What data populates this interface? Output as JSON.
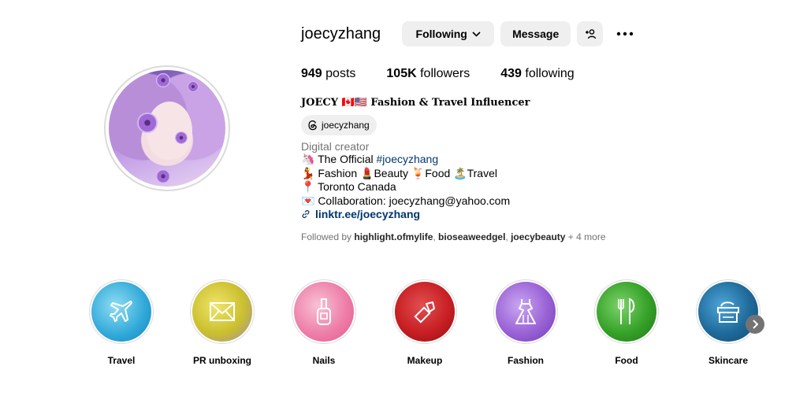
{
  "profile": {
    "username": "joecyzhang",
    "following_label": "Following",
    "message_label": "Message",
    "posts_count": "949",
    "posts_label": "posts",
    "followers_count": "105K",
    "followers_label": "followers",
    "following_count": "439",
    "following_count_label": "following",
    "full_name": "JOECY 🇨🇦🇺🇸 Fashion & Travel Influencer",
    "threads_handle": "joecyzhang",
    "category": "Digital creator",
    "bio": {
      "line1_prefix": "🦄 The Official ",
      "line1_hashtag": "#joecyzhang",
      "line2": "💃 Fashion 💄Beauty 🍹Food 🏝️Travel",
      "line3": "📍 Toronto Canada",
      "line4": "💌 Collaboration: joecyzhang@yahoo.com",
      "link": "linktr.ee/joecyzhang"
    },
    "followed_by_prefix": "Followed by ",
    "followed_by_1": "highlight.ofmylife",
    "followed_by_2": "bioseaweedgel",
    "followed_by_3": "joecybeauty",
    "followed_by_suffix": " + 4 more"
  },
  "highlights": [
    {
      "label": "Travel",
      "icon": "airplane-icon",
      "color": "#2ea8d8"
    },
    {
      "label": "PR unboxing",
      "icon": "envelope-icon",
      "color": "#cbbf2e"
    },
    {
      "label": "Nails",
      "icon": "nail-polish-icon",
      "color": "#ee7fa8"
    },
    {
      "label": "Makeup",
      "icon": "lipstick-icon",
      "color": "#c81f24"
    },
    {
      "label": "Fashion",
      "icon": "dress-icon",
      "color": "#9a62d6"
    },
    {
      "label": "Food",
      "icon": "fork-knife-icon",
      "color": "#36a128"
    },
    {
      "label": "Skincare",
      "icon": "cream-jar-icon",
      "color": "#1f6a9a"
    }
  ]
}
